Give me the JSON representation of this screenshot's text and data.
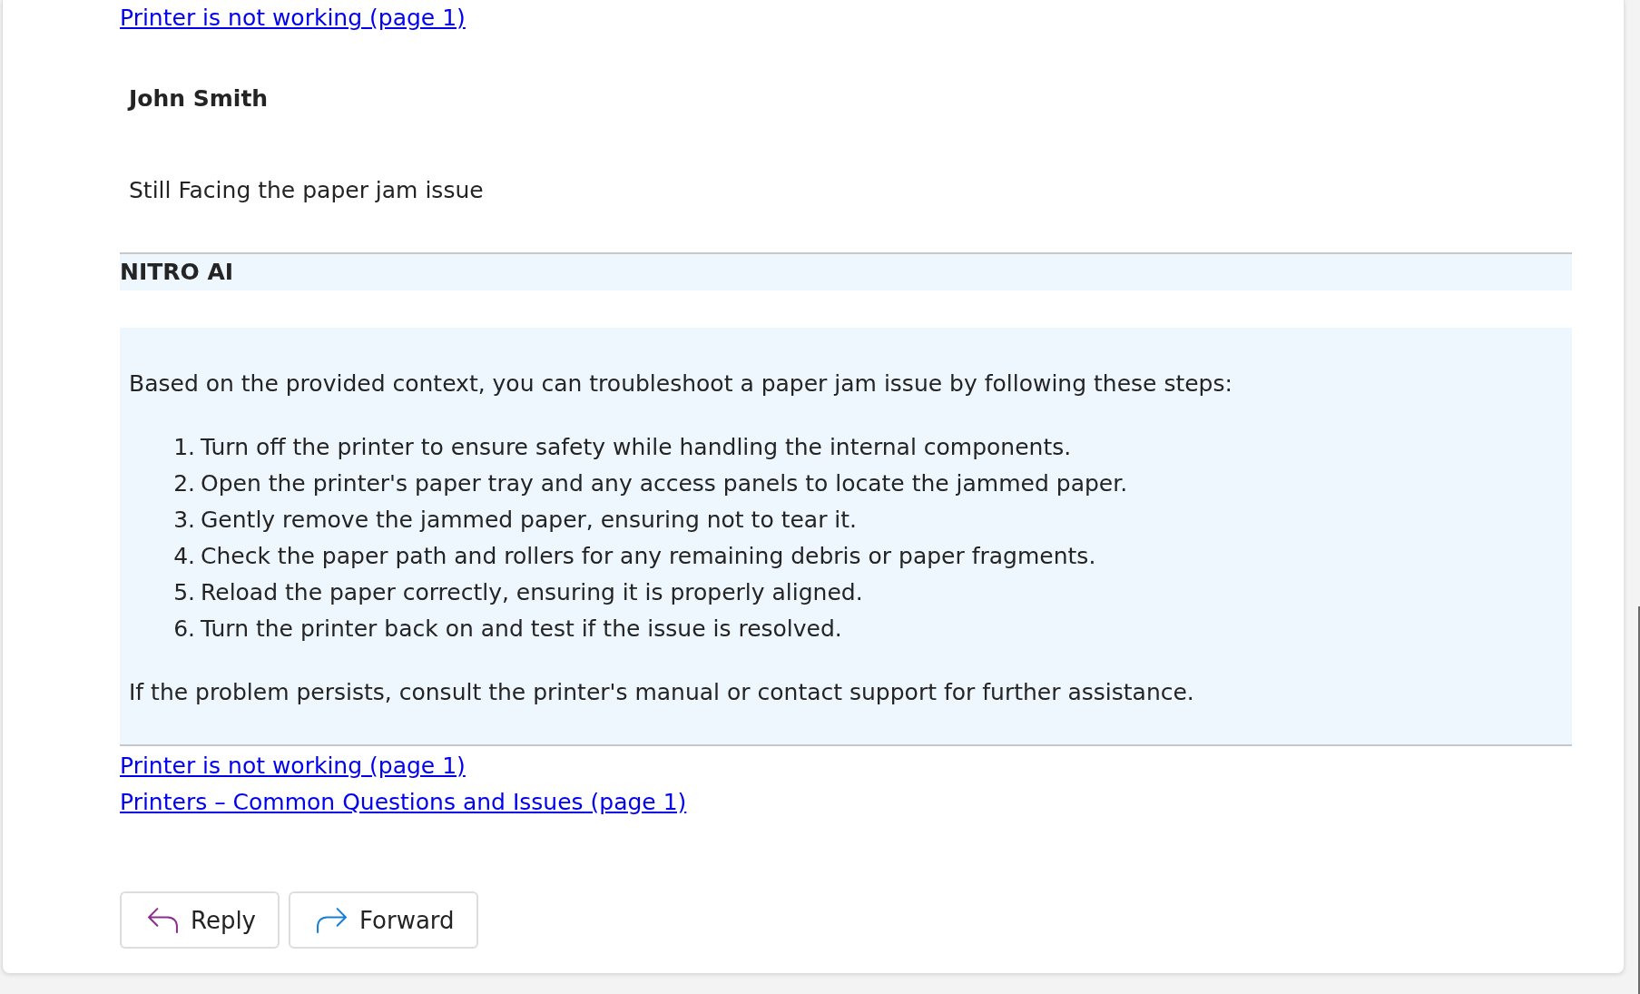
{
  "previous_sources": [
    {
      "text": "Printer is not working (page 1)"
    }
  ],
  "messages": [
    {
      "kind": "user",
      "author": "John Smith",
      "body": "Still Facing the paper jam issue"
    },
    {
      "kind": "ai",
      "author": "NITRO AI",
      "intro": "Based on the provided context, you can troubleshoot a paper jam issue by following these steps:",
      "steps": [
        {
          "number": "1.",
          "text": "Turn off the printer to ensure safety while handling the internal components."
        },
        {
          "number": "2.",
          "text": "Open the printer's paper tray and any access panels to locate the jammed paper."
        },
        {
          "number": "3.",
          "text": "Gently remove the jammed paper, ensuring not to tear it."
        },
        {
          "number": "4.",
          "text": "Check the paper path and rollers for any remaining debris or paper fragments."
        },
        {
          "number": "5.",
          "text": "Reload the paper correctly, ensuring it is properly aligned."
        },
        {
          "number": "6.",
          "text": "Turn the printer back on and test if the issue is resolved."
        }
      ],
      "outro": "If the problem persists, consult the printer's manual or contact support for further assistance.",
      "sources": [
        {
          "text": "Printer is not working (page 1)"
        },
        {
          "text": "Printers – Common Questions and Issues (page 1)"
        }
      ]
    }
  ],
  "actions": [
    {
      "kind": "reply",
      "label": "Reply"
    },
    {
      "kind": "forward",
      "label": "Forward"
    }
  ]
}
